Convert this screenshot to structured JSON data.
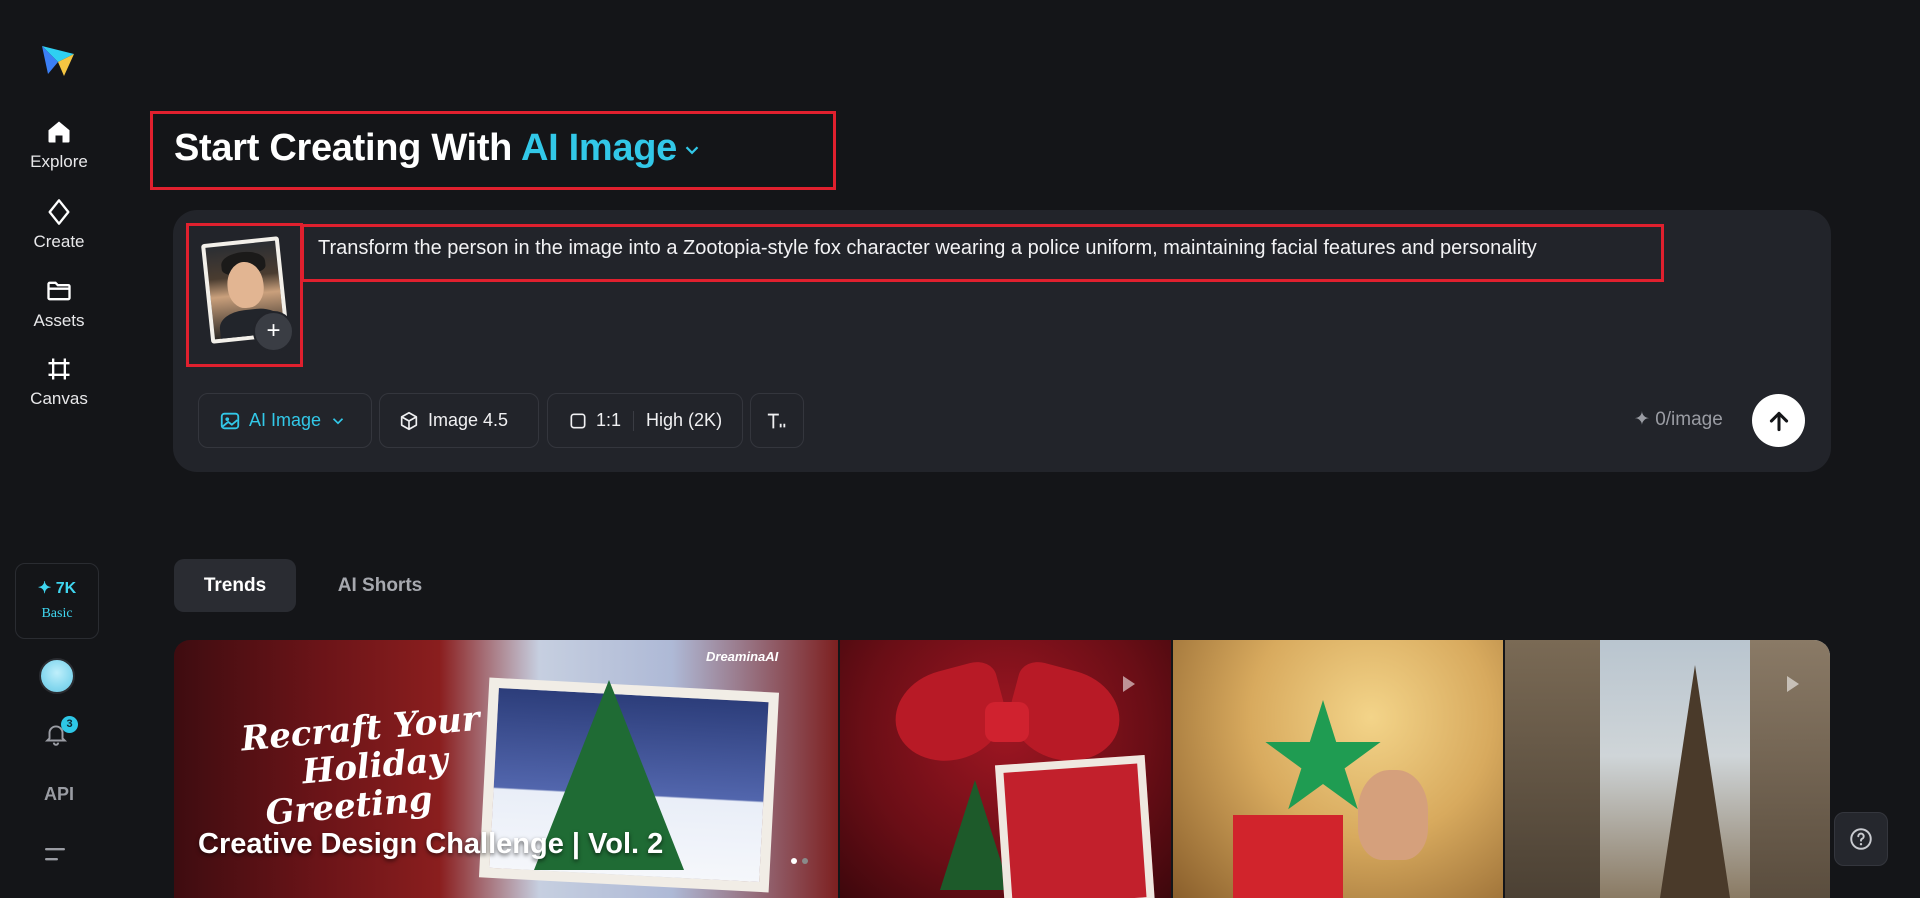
{
  "sidebar": {
    "logo": "dreamina-logo",
    "items": [
      {
        "label": "Explore",
        "icon": "home-icon"
      },
      {
        "label": "Create",
        "icon": "sparkle-diamond-icon"
      },
      {
        "label": "Assets",
        "icon": "folder-icon"
      },
      {
        "label": "Canvas",
        "icon": "frame-icon"
      }
    ],
    "credits": {
      "amount": "✦ 7K",
      "plan": "Basic"
    },
    "notifications_count": "3",
    "api_label": "API"
  },
  "header": {
    "title_prefix": "Start Creating With",
    "title_mode": "AI Image"
  },
  "prompt": {
    "text": "Transform the person in the image into a Zootopia-style fox character wearing a police uniform, maintaining facial features and personality",
    "add_reference_label": "+"
  },
  "toolbar": {
    "mode_label": "AI Image",
    "model_label": "Image 4.5",
    "ratio_label": "1:1",
    "quality_label": "High (2K)",
    "cost_label": "✦ 0/image"
  },
  "tabs": [
    {
      "label": "Trends",
      "active": true
    },
    {
      "label": "AI Shorts",
      "active": false
    }
  ],
  "gallery": {
    "hero": {
      "script_text": [
        "Recraft Your",
        "Holiday",
        "Greeting"
      ],
      "brand": "DreaminaAI",
      "title": "Creative Design Challenge | Vol. 2"
    }
  },
  "colors": {
    "accent": "#32c8e8",
    "background": "#141518",
    "panel": "#22242a",
    "highlight_box": "#e0202e"
  }
}
